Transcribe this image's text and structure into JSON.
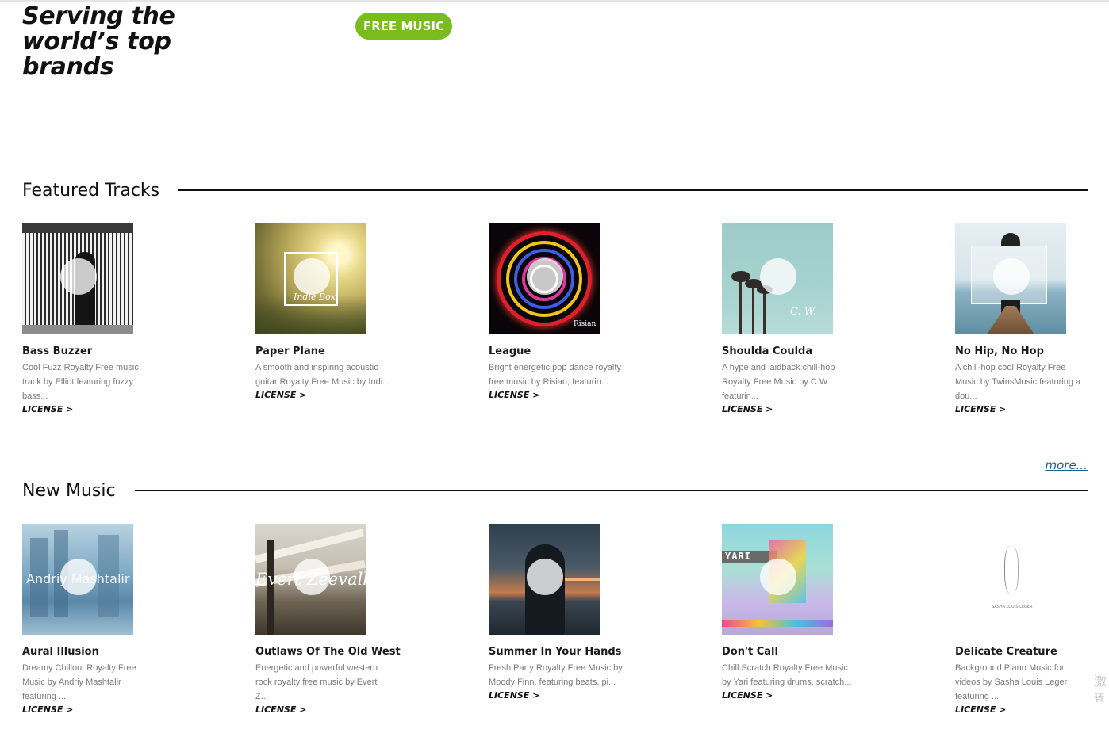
{
  "hero": {
    "title": "Serving the world’s top brands",
    "cta": "FREE MUSIC"
  },
  "featured": {
    "heading": "Featured Tracks",
    "more": "more...",
    "tracks": [
      {
        "title": "Bass Buzzer",
        "desc": "Cool Fuzz Royalty Free music track by Elliot featuring fuzzy bass...",
        "license": "LICENSE >",
        "art_text": ""
      },
      {
        "title": "Paper Plane",
        "desc": "A smooth and inspiring acoustic guitar Royalty Free Music by Indi...",
        "license": "LICENSE >",
        "art_text": "Indie Box"
      },
      {
        "title": "League",
        "desc": "Bright energetic pop dance royalty free music by Risian, featurin...",
        "license": "LICENSE >",
        "art_text": "Risian"
      },
      {
        "title": "Shoulda Coulda",
        "desc": "A hype and laidback chill-hop Royalty Free Music by C.W. featurin...",
        "license": "LICENSE >",
        "art_text": "C. W."
      },
      {
        "title": "No Hip, No Hop",
        "desc": "A chill-hop cool Royalty Free Music by TwinsMusic featuring a dou...",
        "license": "LICENSE >",
        "art_text": ""
      }
    ]
  },
  "new_music": {
    "heading": "New Music",
    "tracks": [
      {
        "title": "Aural Illusion",
        "desc": "Dreamy Chillout Royalty Free Music by Andriy Mashtalir featuring ...",
        "license": "LICENSE >",
        "art_text": "Andriy Mashtalir"
      },
      {
        "title": "Outlaws Of The Old West",
        "desc": "Energetic and powerful western rock royalty free music by Evert Z...",
        "license": "LICENSE >",
        "art_text": "Evert Zeevalkink"
      },
      {
        "title": "Summer In Your Hands",
        "desc": "Fresh Party Royalty Free Music by Moody Finn, featuring beats, pi...",
        "license": "LICENSE >",
        "art_text": ""
      },
      {
        "title": "Don't Call",
        "desc": "Chill Scratch Royalty Free Music by Yari featuring drums, scratch...",
        "license": "LICENSE >",
        "art_text": "YARI"
      },
      {
        "title": "Delicate Creature",
        "desc": "Background Piano Music for videos by Sasha Louis Leger featuring ...",
        "license": "LICENSE >",
        "art_text": "SASHA LOUIS LEGER"
      }
    ]
  },
  "corner": {
    "line1": "激",
    "line2": "转"
  },
  "colors": {
    "accent": "#79bc1e",
    "link": "#1a5f8c",
    "muted": "#7a7a7a"
  }
}
